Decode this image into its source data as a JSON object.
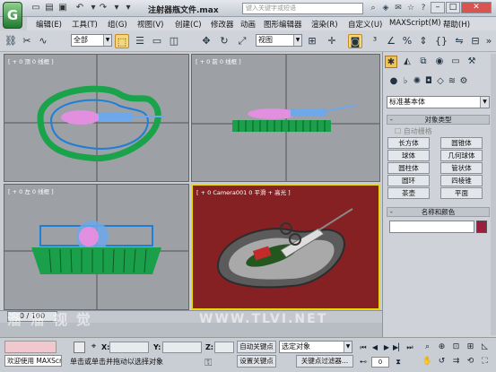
{
  "window": {
    "title": "注射器瓶文件.max",
    "search_placeholder": "键入关键字或短语"
  },
  "menu": [
    "编辑(E)",
    "工具(T)",
    "组(G)",
    "视图(V)",
    "创建(C)",
    "修改器",
    "动画",
    "图形编辑器",
    "渲染(R)",
    "自定义(U)",
    "MAXScript(M)",
    "帮助(H)"
  ],
  "toolbar": {
    "selection_filter": "全部",
    "reference_coord": "视图"
  },
  "viewports": [
    {
      "label": "[ + 0 顶 0 线框 ]"
    },
    {
      "label": "[ + 0 前 0 线框 ]"
    },
    {
      "label": "[ + 0 左 0 线框 ]"
    },
    {
      "label": "[ + 0 Camera001 0 平滑 + 高光 ]"
    }
  ],
  "command_panel": {
    "category": "标准基本体",
    "object_type_title": "对象类型",
    "auto_grid": "自动栅格",
    "objects": [
      "长方体",
      "圆锥体",
      "球体",
      "几何球体",
      "圆柱体",
      "管状体",
      "圆环",
      "四棱锥",
      "茶壶",
      "平面"
    ],
    "name_color_title": "名称和颜色",
    "name_value": "",
    "object_color": "#9a1f3f"
  },
  "timeline": {
    "frame": "0 / 100"
  },
  "status": {
    "welcome": "欢迎使用 MAXScr",
    "prompt": "单击或单击并拖动以选择对象",
    "x_label": "X:",
    "y_label": "Y:",
    "z_label": "Z:",
    "auto_key": "自动关键点",
    "set_key": "设置关键点",
    "selected_combo": "选定对象",
    "key_filters": "关键点过滤器..."
  },
  "watermark": {
    "left": "溜 溜 视 觉",
    "right": "WWW.TLVI.NET"
  }
}
